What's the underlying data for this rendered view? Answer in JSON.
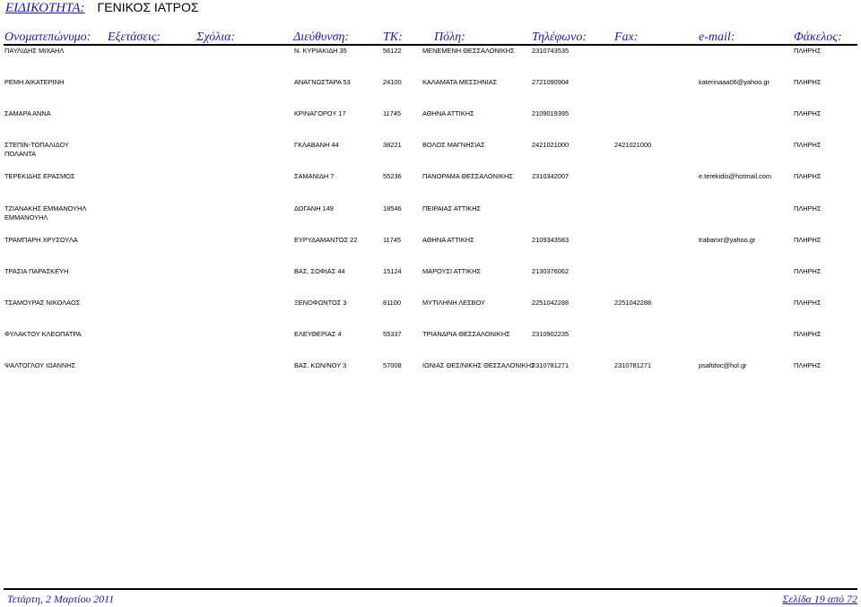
{
  "specialty": {
    "label": "ΕΙΔΙΚΟΤΗΤΑ:",
    "value": "ΓΕΝΙΚΟΣ ΙΑΤΡΟΣ"
  },
  "columns": [
    "Ονοματεπώνυμο:",
    "Εξετάσεις:",
    "Σχόλια:",
    "Διεύθυνση:",
    "ΤΚ:",
    "Πόλη:",
    "Τηλέφωνο:",
    "Fax:",
    "e-mail:",
    "Φάκελος:"
  ],
  "rows": [
    {
      "name": "ΠΑΥΛΙΔΗΣ ΜΙΧΑΗΛ",
      "address": "Ν. ΚΥΡΙΑΚΙΔΗ 35",
      "tk": "56122",
      "city": "ΜΕΝΕΜΕΝΗ ΘΕΣΣΑΛΟΝΙΚΗΣ",
      "phone": "2310743535",
      "fax": "",
      "email": "",
      "folder": "ΠΛΗΡΗΣ"
    },
    {
      "name": "ΡΕΜΗ ΑΙΚΑΤΕΡΙΝΗ",
      "address": "ΑΝΑΓΝΩΣΤΑΡΑ 53",
      "tk": "24100",
      "city": "ΚΑΛΑΜΑΤΑ ΜΕΣΣΗΝΙΑΣ",
      "phone": "2721090904",
      "fax": "",
      "email": "katerinaaa06@yahoo.gr",
      "folder": "ΠΛΗΡΗΣ"
    },
    {
      "name": "ΣΑΜΑΡΑ ΑΝΝΑ",
      "address": "ΚΡΙΝΑΓΟΡΟΥ 17",
      "tk": "11745",
      "city": "ΑΘΗΝΑ ΑΤΤΙΚΗΣ",
      "phone": "2109019395",
      "fax": "",
      "email": "",
      "folder": "ΠΛΗΡΗΣ"
    },
    {
      "name": "ΣΤΕΠΙΝ-ΤΟΠΑΛΙΔΟΥ ΠΟΛΑΝΤΑ",
      "address": "ΓΚΛΑΒΑΝΗ 44",
      "tk": "38221",
      "city": "ΒΟΛΟΣ ΜΑΓΝΗΣΙΑΣ",
      "phone": "2421021000",
      "fax": "2421021000",
      "email": "",
      "folder": "ΠΛΗΡΗΣ"
    },
    {
      "name": "ΤΕΡΕΚΙΔΗΣ ΕΡΑΣΜΟΣ",
      "address": "ΣΑΜΑΝΙΔΗ 7",
      "tk": "55236",
      "city": "ΠΑΝΟΡΑΜΑ ΘΕΣΣΑΛΟΝΙΚΗΣ",
      "phone": "2310342007",
      "fax": "",
      "email": "e.terekidis@hotmail.com",
      "folder": "ΠΛΗΡΗΣ"
    },
    {
      "name": "ΤΖΙΑΝΑΚΗΣ ΕΜΜΑΝΟΥΗΛ ΕΜΜΑΝΟΥΗΛ",
      "address": "ΔΟΓΑΝΗ 149",
      "tk": "18546",
      "city": "ΠΕΙΡΑΙΑΣ ΑΤΤΙΚΗΣ",
      "phone": "",
      "fax": "",
      "email": "",
      "folder": "ΠΛΗΡΗΣ"
    },
    {
      "name": "ΤΡΑΜΠΑΡΗ ΧΡΥΣΟΥΛΑ",
      "address": "ΕΥΡΥΔΑΜΑΝΤΟΣ 22",
      "tk": "11745",
      "city": "ΑΘΗΝΑ ΑΤΤΙΚΗΣ",
      "phone": "2109343583",
      "fax": "",
      "email": "trabarixr@yahoo.gr",
      "folder": "ΠΛΗΡΗΣ"
    },
    {
      "name": "ΤΡΑΣΙΑ ΠΑΡΑΣΚΕΥΗ",
      "address": "ΒΑΣ. ΣΟΦΙΑΣ 44",
      "tk": "15124",
      "city": "ΜΑΡΟΥΣΙ ΑΤΤΙΚΗΣ",
      "phone": "2130376062",
      "fax": "",
      "email": "",
      "folder": "ΠΛΗΡΗΣ"
    },
    {
      "name": "ΤΣΑΜΟΥΡΑΣ ΝΙΚΟΛΑΟΣ",
      "address": "ΞΕΝΟΦΩΝΤΟΣ 3",
      "tk": "81100",
      "city": "ΜΥΤΙΛΗΝΗ ΛΕΣΒΟΥ",
      "phone": "2251042288",
      "fax": "2251042288",
      "email": "",
      "folder": "ΠΛΗΡΗΣ"
    },
    {
      "name": "ΦΥΛΑΚΤΟΥ ΚΛΕΟΠΑΤΡΑ",
      "address": "ΕΛΕΥΘΕΡΙΑΣ 4",
      "tk": "55337",
      "city": "ΤΡΙΑΝΔΡΙΑ ΘΕΣΣΑΛΟΝΙΚΗΣ",
      "phone": "2310902235",
      "fax": "",
      "email": "",
      "folder": "ΠΛΗΡΗΣ"
    },
    {
      "name": "ΨΑΛΤΟΓΛΟΥ ΙΩΑΝΝΗΣ",
      "address": "ΒΑΣ. ΚΩΝ/ΝΟΥ 3",
      "tk": "57008",
      "city": "ΙΩΝΙΑΣ ΘΕΣ/ΝΙΚΗΣ ΘΕΣΣΑΛΟΝΙΚΗΣ",
      "phone": "2310781271",
      "fax": "2310781271",
      "email": "psaltdoc@hol.gr",
      "folder": "ΠΛΗΡΗΣ"
    }
  ],
  "footer": {
    "date": "Τετάρτη, 2 Μαρτίου 2011",
    "page": "Σελίδα 19 από 72"
  }
}
